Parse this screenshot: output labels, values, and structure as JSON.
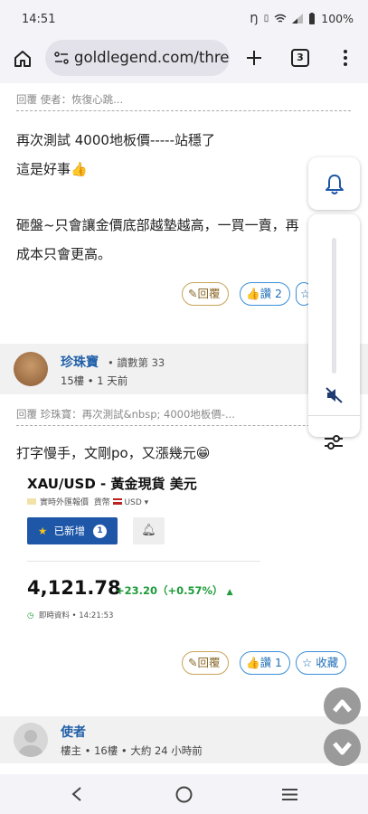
{
  "status": {
    "time": "14:51",
    "battery": "100%"
  },
  "browser": {
    "url": "goldlegend.com/threa",
    "tab_count": "3"
  },
  "post1": {
    "quote": "回覆 使者：恢復心跳...",
    "lines": [
      "再次測試  4000地板價-----站穩了",
      "這是好事👍",
      "砸盤~只會讓金價底部越墊越高，一買一賣，再",
      "成本只會更高。"
    ],
    "reply_label": "回覆",
    "like_label": "讚 2"
  },
  "user2": {
    "name": "珍珠寶",
    "read_count": "• 讀數第 33",
    "meta": "15樓 • 1 天前"
  },
  "post2": {
    "quote": "回覆 珍珠寶：再次測試&nbsp; 4000地板價-...",
    "text": "打字慢手，文剛po，又漲幾元😁",
    "reply_label": "回覆",
    "like_label": "讚 1",
    "fav_label": "收藏"
  },
  "widget": {
    "title": "XAU/USD - 黃金現貨 美元",
    "subtitle_a": "實時外匯報價",
    "subtitle_b": "貨幣",
    "subtitle_currency": "USD",
    "added_label": "已新增",
    "added_count": "1",
    "price": "4,121.78",
    "change": "+23.20（+0.57%）",
    "realtime": "即時資料 • 14:21:53",
    "colors": {
      "up": "#1e9b3a",
      "button": "#1e57a8"
    }
  },
  "user3": {
    "name": "使者",
    "meta": "樓主 • 16樓 • 大約 24 小時前"
  }
}
